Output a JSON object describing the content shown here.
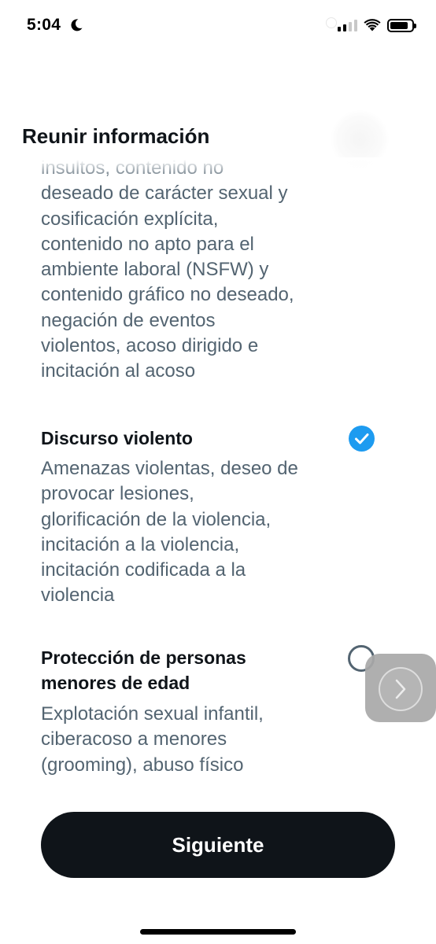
{
  "status_bar": {
    "time": "5:04",
    "focus_icon": "moon-icon",
    "icons": [
      "signal-icon",
      "wifi-icon",
      "battery-icon"
    ]
  },
  "header": {
    "title": "Reunir información"
  },
  "sections": [
    {
      "title": "",
      "lines": [
        "insultos, contenido no",
        "deseado de carácter sexual y",
        "cosificación explícita,",
        "contenido no apto para el",
        "ambiente laboral (NSFW) y",
        "contenido gráfico no deseado,",
        "negación de eventos",
        "violentos, acoso dirigido e",
        "incitación al acoso"
      ]
    },
    {
      "title": "Discurso violento",
      "selected": true,
      "lines": [
        "Amenazas violentas, deseo de",
        "provocar lesiones,",
        "glorificación de la violencia,",
        "incitación a la violencia,",
        "incitación codificada a la",
        "violencia"
      ]
    },
    {
      "title_lines": [
        "Protección de personas",
        "menores de edad"
      ],
      "selected": false,
      "lines": [
        "Explotación sexual infantil,",
        "ciberacoso a menores",
        "(grooming), abuso físico"
      ]
    }
  ],
  "primary_button": {
    "label": "Siguiente"
  },
  "colors": {
    "accent": "#1d9bf0",
    "text_primary": "#0f1419",
    "text_secondary": "#536471",
    "button_bg": "#0f1419"
  }
}
